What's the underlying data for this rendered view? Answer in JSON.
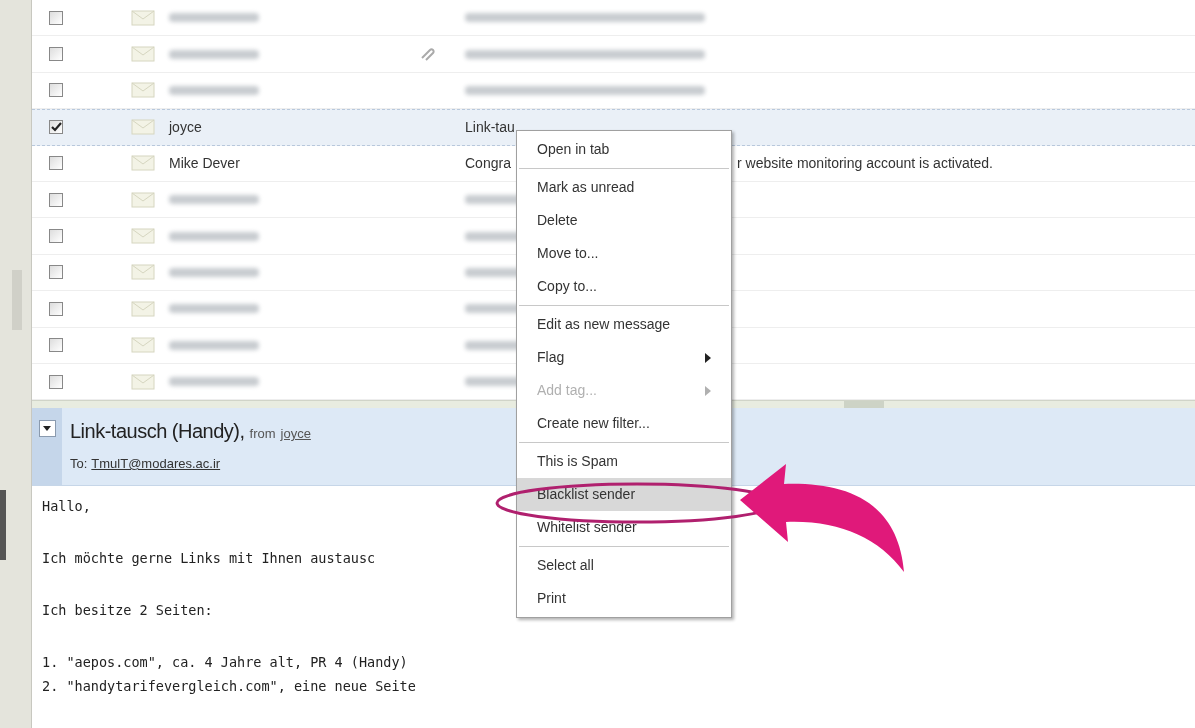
{
  "message_list": {
    "rows": [
      {
        "kind": "blurred",
        "checked": false,
        "selected": false
      },
      {
        "kind": "blurred",
        "checked": false,
        "selected": false,
        "attachment": true
      },
      {
        "kind": "blurred",
        "checked": false,
        "selected": false
      },
      {
        "kind": "text",
        "checked": true,
        "selected": true,
        "sender": "joyce",
        "subject": "Link-tau"
      },
      {
        "kind": "text",
        "checked": false,
        "selected": false,
        "sender": "Mike Dever",
        "subject": "Congra",
        "subject_tail": "r website monitoring account is activated."
      },
      {
        "kind": "blurred",
        "checked": false,
        "selected": false
      },
      {
        "kind": "blurred",
        "checked": false,
        "selected": false
      },
      {
        "kind": "blurred",
        "checked": false,
        "selected": false
      },
      {
        "kind": "blurred",
        "checked": false,
        "selected": false
      },
      {
        "kind": "blurred",
        "checked": false,
        "selected": false
      },
      {
        "kind": "blurred",
        "checked": false,
        "selected": false
      }
    ]
  },
  "preview": {
    "subject": "Link-tausch (Handy),",
    "from_label": "from",
    "from": "joyce",
    "to_label": "To:",
    "to": "TmulT@modares.ac.ir",
    "body": [
      [
        "Hallo,"
      ],
      [
        "Ich möchte gerne Links mit Ihnen austausc"
      ],
      [
        "Ich besitze 2 Seiten:"
      ],
      [
        "1. \"aepos.com\", ca. 4 Jahre alt, PR 4 (Handy)",
        "2. \"handytarifevergleich.com\", eine neue Seite"
      ]
    ]
  },
  "context_menu": {
    "items": [
      {
        "kind": "item",
        "label": "Open in tab",
        "disabled": false,
        "submenu": false,
        "selected": false
      },
      {
        "kind": "separator"
      },
      {
        "kind": "item",
        "label": "Mark as unread",
        "disabled": false,
        "submenu": false,
        "selected": false
      },
      {
        "kind": "item",
        "label": "Delete",
        "disabled": false,
        "submenu": false,
        "selected": false
      },
      {
        "kind": "item",
        "label": "Move to...",
        "disabled": false,
        "submenu": false,
        "selected": false
      },
      {
        "kind": "item",
        "label": "Copy to...",
        "disabled": false,
        "submenu": false,
        "selected": false
      },
      {
        "kind": "separator"
      },
      {
        "kind": "item",
        "label": "Edit as new message",
        "disabled": false,
        "submenu": false,
        "selected": false
      },
      {
        "kind": "item",
        "label": "Flag",
        "disabled": false,
        "submenu": true,
        "selected": false
      },
      {
        "kind": "item",
        "label": "Add tag...",
        "disabled": true,
        "submenu": true,
        "selected": false
      },
      {
        "kind": "item",
        "label": "Create new filter...",
        "disabled": false,
        "submenu": false,
        "selected": false
      },
      {
        "kind": "separator"
      },
      {
        "kind": "item",
        "label": "This is Spam",
        "disabled": false,
        "submenu": false,
        "selected": false
      },
      {
        "kind": "item",
        "label": "Blacklist sender",
        "disabled": false,
        "submenu": false,
        "selected": true
      },
      {
        "kind": "item",
        "label": "Whitelist sender",
        "disabled": false,
        "submenu": false,
        "selected": false
      },
      {
        "kind": "separator"
      },
      {
        "kind": "item",
        "label": "Select all",
        "disabled": false,
        "submenu": false,
        "selected": false
      },
      {
        "kind": "item",
        "label": "Print",
        "disabled": false,
        "submenu": false,
        "selected": false
      }
    ]
  }
}
